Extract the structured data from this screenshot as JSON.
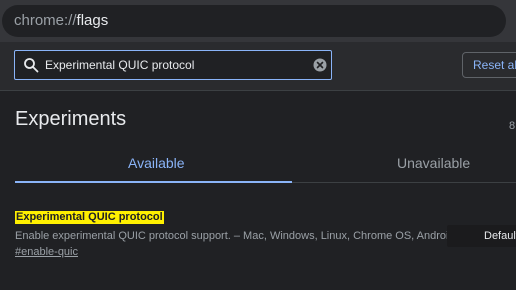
{
  "address_bar": {
    "scheme": "chrome://",
    "path": "flags"
  },
  "search": {
    "value": "Experimental QUIC protocol",
    "icon": "search-icon",
    "clear_icon": "clear-circle-icon"
  },
  "reset_button_label": "Reset all",
  "page": {
    "title": "Experiments",
    "version_partial": "8"
  },
  "tabs": [
    {
      "label": "Available",
      "active": true
    },
    {
      "label": "Unavailable",
      "active": false
    }
  ],
  "experiment": {
    "name": "Experimental QUIC protocol",
    "description": "Enable experimental QUIC protocol support. – Mac, Windows, Linux, Chrome OS, Android",
    "anchor": "#enable-quic",
    "selected_option": "Default"
  },
  "colors": {
    "background": "#202124",
    "accent": "#8ab4f8",
    "highlight": "#fff000"
  }
}
